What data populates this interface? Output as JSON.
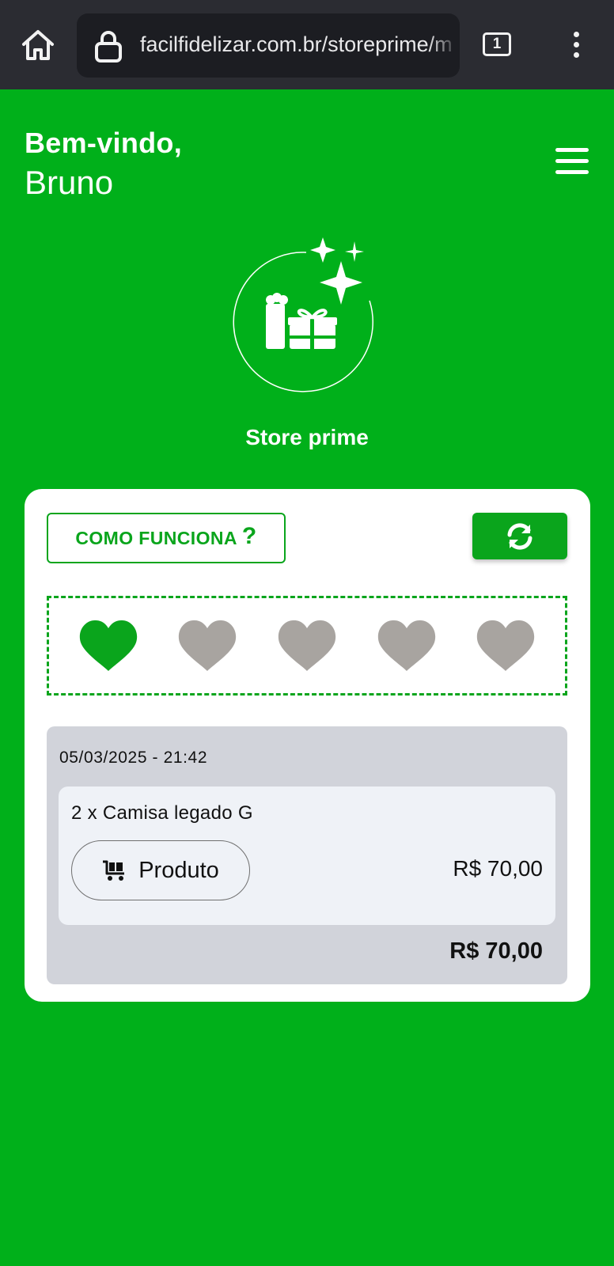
{
  "browser": {
    "url": "facilfidelizar.com.br/storeprime/m",
    "tab_count": "1"
  },
  "header": {
    "greeting": "Bem-vindo,",
    "user_name": "Bruno"
  },
  "brand": {
    "name": "Store prime"
  },
  "card": {
    "how_it_works_label": "COMO FUNCIONA",
    "how_it_works_mark": "?",
    "hearts": {
      "total": 5,
      "filled": 1,
      "filled_color": "#0aa51c",
      "empty_color": "#a8a4a0"
    },
    "purchase": {
      "datetime": "05/03/2025 - 21:42",
      "item_name": "2 x Camisa legado G",
      "item_type": "Produto",
      "item_price": "R$ 70,00",
      "total": "R$ 70,00"
    }
  },
  "colors": {
    "background": "#00b01a",
    "accent": "#0aa51c",
    "browser_bar": "#2b2c32"
  }
}
